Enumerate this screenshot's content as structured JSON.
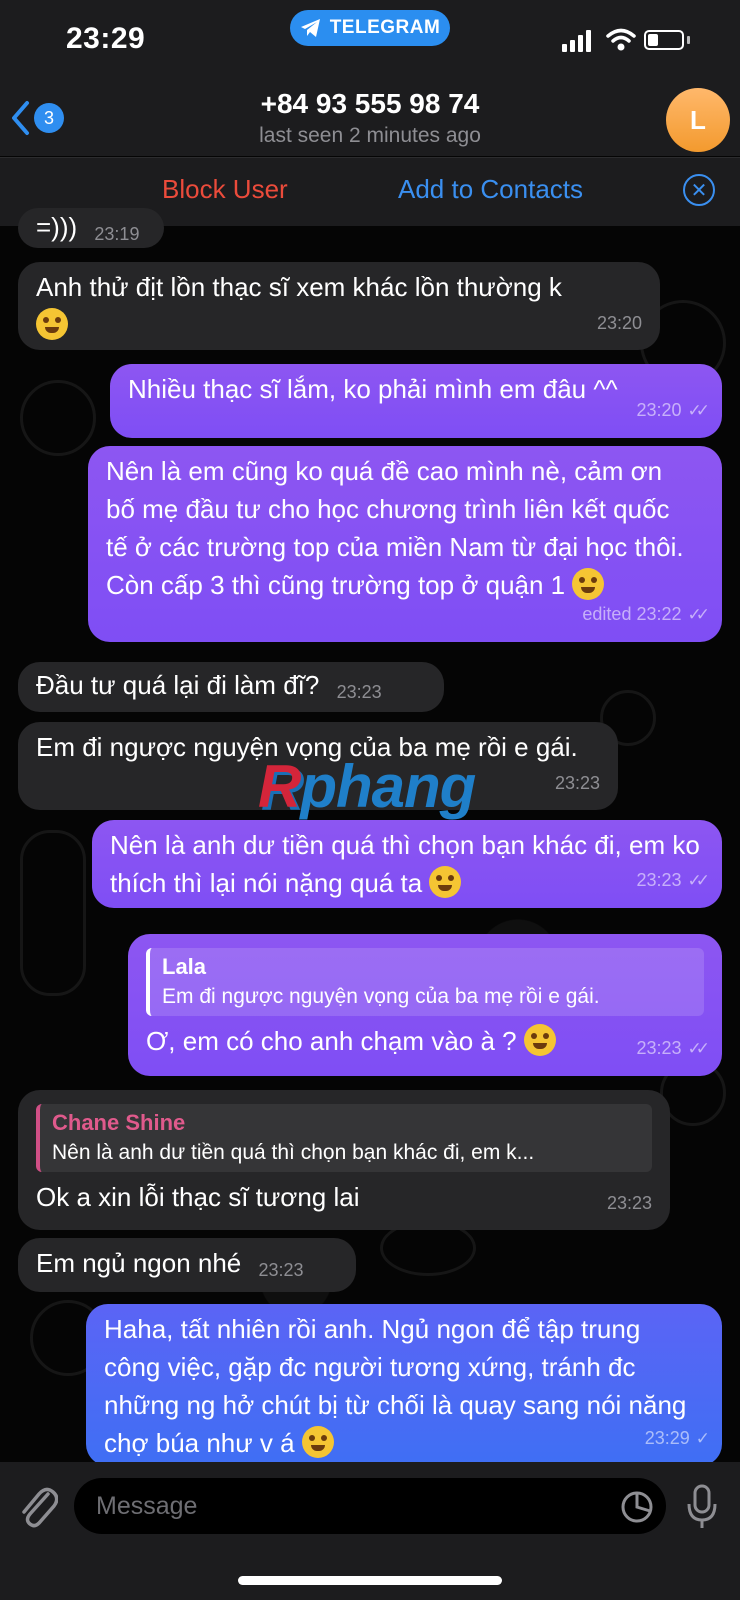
{
  "status_bar": {
    "time": "23:29",
    "app_pill": "TELEGRAM"
  },
  "header": {
    "back_badge": "3",
    "title": "+84 93 555 98 74",
    "subtitle": "last seen 2 minutes ago",
    "avatar_letter": "L"
  },
  "action_bar": {
    "block_label": "Block User",
    "add_label": "Add to Contacts"
  },
  "messages": [
    {
      "dir": "in",
      "text": "=)))",
      "time": "23:19"
    },
    {
      "dir": "in",
      "text": "Anh thử địt lồn thạc sĩ xem khác lồn thường k",
      "time": "23:20",
      "emoji": "laugh-emoji"
    },
    {
      "dir": "out",
      "text": "Nhiều thạc sĩ lắm, ko phải mình em đâu ^^",
      "time": "23:20"
    },
    {
      "dir": "out",
      "text": "Nên là em cũng ko quá đề cao mình nè, cảm ơn bố mẹ đầu tư cho học chương trình liên kết quốc tế ở các trường top của miền Nam từ đại học thôi. Còn cấp 3 thì cũng trường top ở quận 1",
      "time": "edited 23:22",
      "emoji": "laugh-emoji"
    },
    {
      "dir": "in",
      "text": "Đầu tư quá lại đi làm đĩ?",
      "time": "23:23"
    },
    {
      "dir": "in",
      "text": "Em đi ngược nguyện vọng của ba mẹ rồi e gái.",
      "time": "23:23"
    },
    {
      "dir": "out",
      "text": "Nên là anh dư tiền quá thì chọn bạn khác đi, em ko thích thì lại nói nặng quá ta",
      "time": "23:23",
      "emoji": "pleading-emoji"
    },
    {
      "dir": "out",
      "reply_name": "Lala",
      "reply_text": "Em đi ngược nguyện vọng của ba mẹ rồi e gái.",
      "text": "Ơ, em có cho anh chạm vào à ?",
      "time": "23:23",
      "emoji": "laugh-emoji"
    },
    {
      "dir": "in",
      "reply_name": "Chane Shine",
      "reply_text": "Nên là anh dư tiền quá thì chọn bạn khác đi, em k...",
      "text": "Ok a xin lỗi thạc sĩ tương lai",
      "time": "23:23"
    },
    {
      "dir": "in",
      "text": "Em ngủ ngon nhé",
      "time": "23:23"
    },
    {
      "dir": "out",
      "text": "Haha, tất nhiên rồi anh. Ngủ ngon để tập trung công việc, gặp đc người tương xứng, tránh đc những ng hở chút bị từ chối là quay sang nói năng chợ búa như v á",
      "time": "23:29",
      "emoji": "pleading-emoji"
    }
  ],
  "watermark": {
    "text": "Rphang"
  },
  "composer": {
    "placeholder": "Message"
  },
  "colors": {
    "outgoing": "#8d56f2",
    "outgoing_last": "#3f6ff4",
    "incoming": "#262628",
    "link": "#3a8ff0",
    "danger": "#eb4b3b"
  }
}
